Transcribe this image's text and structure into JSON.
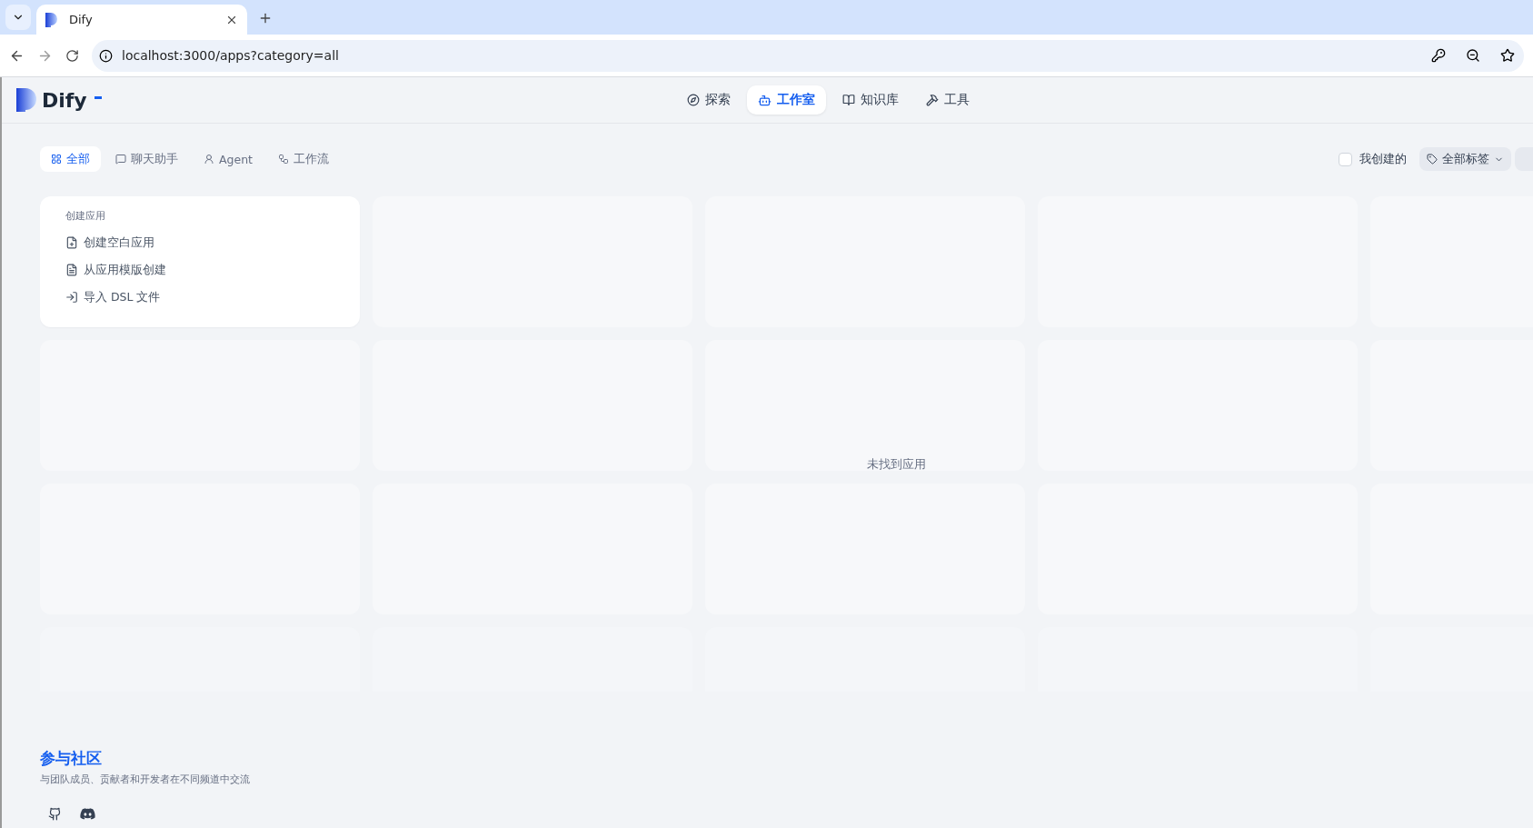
{
  "browser": {
    "tab_title": "Dify",
    "url": "localhost:3000/apps?category=all"
  },
  "header": {
    "logo": "Dify",
    "nav": [
      {
        "label": "探索",
        "selected": false
      },
      {
        "label": "工作室",
        "selected": true
      },
      {
        "label": "知识库",
        "selected": false
      },
      {
        "label": "工具",
        "selected": false
      }
    ]
  },
  "filters": {
    "categories": [
      {
        "label": "全部",
        "selected": true
      },
      {
        "label": "聊天助手",
        "selected": false
      },
      {
        "label": "Agent",
        "selected": false
      },
      {
        "label": "工作流",
        "selected": false
      }
    ],
    "created_by_me": {
      "label": "我创建的",
      "checked": false
    },
    "tags": {
      "label": "全部标签"
    }
  },
  "create_card": {
    "title": "创建应用",
    "actions": [
      {
        "label": "创建空白应用"
      },
      {
        "label": "从应用模版创建"
      },
      {
        "label": "导入 DSL 文件"
      }
    ]
  },
  "empty_message": "未找到应用",
  "footer": {
    "title": "参与社区",
    "description": "与团队成员、贡献者和开发者在不同频道中交流"
  }
}
